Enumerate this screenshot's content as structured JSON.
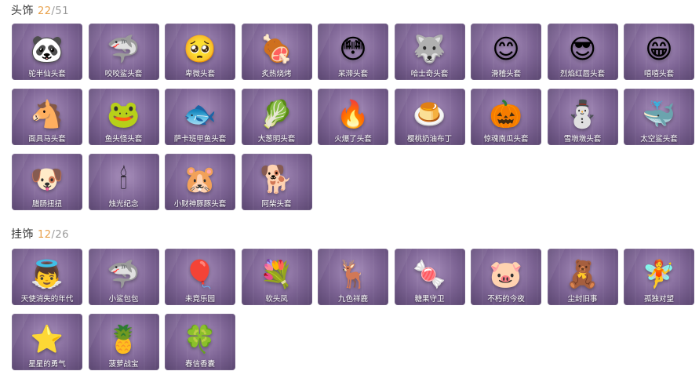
{
  "headwear": {
    "title": "头饰",
    "owned": "22",
    "total": "/51",
    "items": [
      {
        "label": "驼半仙头套",
        "icon": "panda-bear-head-icon",
        "glyph": "🐼"
      },
      {
        "label": "咬咬鲨头套",
        "icon": "shark-head-icon",
        "glyph": "🦈"
      },
      {
        "label": "卑微头套",
        "icon": "sad-emoji-head-icon",
        "glyph": "🥺"
      },
      {
        "label": "炙热烧烤",
        "icon": "bbq-meat-head-icon",
        "glyph": "🍖"
      },
      {
        "label": "呆滞头套",
        "icon": "dazed-emoji-head-icon",
        "glyph": "😳"
      },
      {
        "label": "哈士奇头套",
        "icon": "husky-head-icon",
        "glyph": "🐺"
      },
      {
        "label": "滑稽头套",
        "icon": "funny-emoji-head-icon",
        "glyph": "😊"
      },
      {
        "label": "烈焰红唇头套",
        "icon": "pikachu-sunglasses-head-icon",
        "glyph": "😎"
      },
      {
        "label": "嘻嘻头套",
        "icon": "grin-emoji-head-icon",
        "glyph": "😁"
      },
      {
        "label": "面具马头套",
        "icon": "horse-head-icon",
        "glyph": "🐴"
      },
      {
        "label": "鱼头怪头套",
        "icon": "fish-monster-head-icon",
        "glyph": "🐸"
      },
      {
        "label": "萨卡班甲鱼头套",
        "icon": "fish-head-icon",
        "glyph": "🐟"
      },
      {
        "label": "大葱明头套",
        "icon": "scallion-head-icon",
        "glyph": "🥬"
      },
      {
        "label": "火爆了头套",
        "icon": "fire-head-icon",
        "glyph": "🔥"
      },
      {
        "label": "樱桃奶油布丁",
        "icon": "pudding-head-icon",
        "glyph": "🍮"
      },
      {
        "label": "惊魂南瓜头套",
        "icon": "pumpkin-head-icon",
        "glyph": "🎃"
      },
      {
        "label": "雪墩墩头套",
        "icon": "snowman-head-icon",
        "glyph": "⛄"
      },
      {
        "label": "太空鲨头套",
        "icon": "space-shark-head-icon",
        "glyph": "🐳"
      },
      {
        "label": "腊肠扭扭",
        "icon": "dachshund-head-icon",
        "glyph": "🐶"
      },
      {
        "label": "烛光纪念",
        "icon": "candle-head-icon",
        "glyph": "🕯"
      },
      {
        "label": "小财神豚豚头套",
        "icon": "capybara-head-icon",
        "glyph": "🐹"
      },
      {
        "label": "阿柴头套",
        "icon": "shiba-head-icon",
        "glyph": "🐕"
      }
    ]
  },
  "pendants": {
    "title": "挂饰",
    "owned": "12",
    "total": "/26",
    "items": [
      {
        "label": "天使消失的年代",
        "icon": "angel-pendant-icon",
        "glyph": "👼"
      },
      {
        "label": "小鲨包包",
        "icon": "shark-bag-pendant-icon",
        "glyph": "🦈"
      },
      {
        "label": "未竟乐园",
        "icon": "bunny-balloon-pendant-icon",
        "glyph": "🎈"
      },
      {
        "label": "软头凤",
        "icon": "flower-pendant-icon",
        "glyph": "💐"
      },
      {
        "label": "九色祥鹿",
        "icon": "deer-pendant-icon",
        "glyph": "🦌"
      },
      {
        "label": "糖果守卫",
        "icon": "candy-pendant-icon",
        "glyph": "🍬"
      },
      {
        "label": "不朽的今夜",
        "icon": "pink-creature-pendant-icon",
        "glyph": "🐷"
      },
      {
        "label": "尘封旧事",
        "icon": "doll-pendant-icon",
        "glyph": "🧸"
      },
      {
        "label": "孤独对望",
        "icon": "fairy-pendant-icon",
        "glyph": "🧚"
      },
      {
        "label": "星星的勇气",
        "icon": "star-pendant-icon",
        "glyph": "⭐"
      },
      {
        "label": "菠萝战宝",
        "icon": "pineapple-pendant-icon",
        "glyph": "🍍"
      },
      {
        "label": "春信香囊",
        "icon": "sachet-pendant-icon",
        "glyph": "🍀"
      }
    ]
  }
}
